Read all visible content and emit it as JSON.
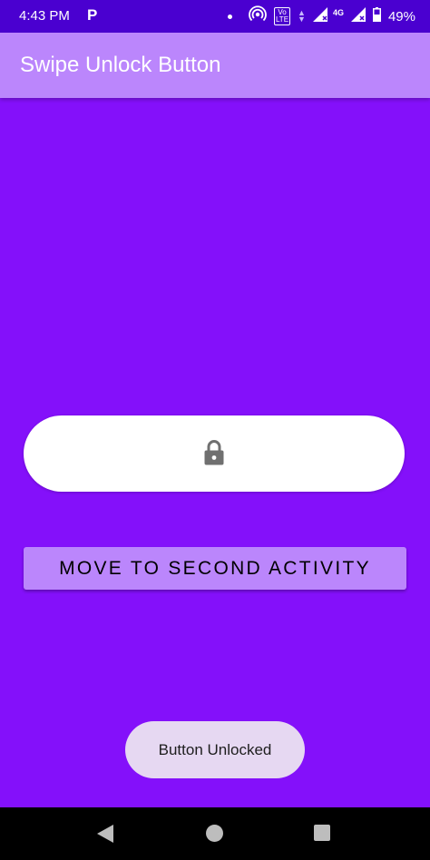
{
  "status_bar": {
    "time": "4:43 PM",
    "app_badge": "P",
    "network_type": "4G",
    "volte_label": "Vo\nLTE",
    "battery_percent": "49%",
    "icons": [
      "notification-dot-icon",
      "hotspot-icon",
      "volte-icon",
      "data-arrows-icon",
      "signal-icon",
      "battery-icon"
    ]
  },
  "app_bar": {
    "title": "Swipe Unlock Button"
  },
  "swipe": {
    "icon": "lock-icon",
    "track_color": "#ffffff"
  },
  "main": {
    "move_button_label": "MOVE TO SECOND ACTIVITY"
  },
  "toast": {
    "message": "Button Unlocked"
  },
  "colors": {
    "background": "#8410fa",
    "status_bar": "#4a00d0",
    "app_bar": "#bb86fc",
    "button": "#bb86fc",
    "toast": "#e6d8f2"
  },
  "nav_bar": {
    "icons": [
      "back-icon",
      "home-icon",
      "recents-icon"
    ]
  }
}
